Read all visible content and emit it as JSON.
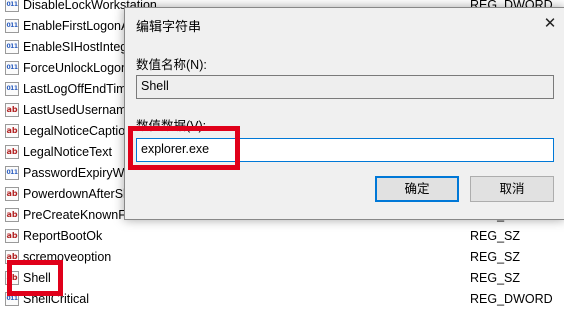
{
  "registry": {
    "rows": [
      {
        "name": "DisableLockWorkstation",
        "type": "REG_DWORD",
        "icon": "binary-value-icon"
      },
      {
        "name": "EnableFirstLogonAnimation",
        "type": "",
        "icon": "binary-value-icon"
      },
      {
        "name": "EnableSIHostIntegration",
        "type": "",
        "icon": "binary-value-icon"
      },
      {
        "name": "ForceUnlockLogon",
        "type": "",
        "icon": "binary-value-icon"
      },
      {
        "name": "LastLogOffEndTimePerfCounter",
        "type": "",
        "icon": "binary-value-icon"
      },
      {
        "name": "LastUsedUsername",
        "type": "",
        "icon": "string-value-icon"
      },
      {
        "name": "LegalNoticeCaption",
        "type": "",
        "icon": "string-value-icon"
      },
      {
        "name": "LegalNoticeText",
        "type": "",
        "icon": "string-value-icon"
      },
      {
        "name": "PasswordExpiryWarning",
        "type": "",
        "icon": "binary-value-icon"
      },
      {
        "name": "PowerdownAfterShutdown",
        "type": "",
        "icon": "string-value-icon"
      },
      {
        "name": "PreCreateKnownFolders",
        "type": "REG_SZ",
        "icon": "string-value-icon"
      },
      {
        "name": "ReportBootOk",
        "type": "REG_SZ",
        "icon": "string-value-icon"
      },
      {
        "name": "scremoveoption",
        "type": "REG_SZ",
        "icon": "string-value-icon"
      },
      {
        "name": "Shell",
        "type": "REG_SZ",
        "icon": "string-value-icon"
      },
      {
        "name": "ShellCritical",
        "type": "REG_DWORD",
        "icon": "binary-value-icon"
      }
    ]
  },
  "dialog": {
    "title": "编辑字符串",
    "close_glyph": "✕",
    "value_name_label": "数值名称(N):",
    "value_name": "Shell",
    "value_data_label": "数值数据(V):",
    "value_data": "explorer.exe",
    "ok_label": "确定",
    "cancel_label": "取消"
  },
  "colors": {
    "highlight_box": "#e0001a",
    "focus_border": "#0078d7",
    "dialog_bg": "#f0f0f0"
  }
}
